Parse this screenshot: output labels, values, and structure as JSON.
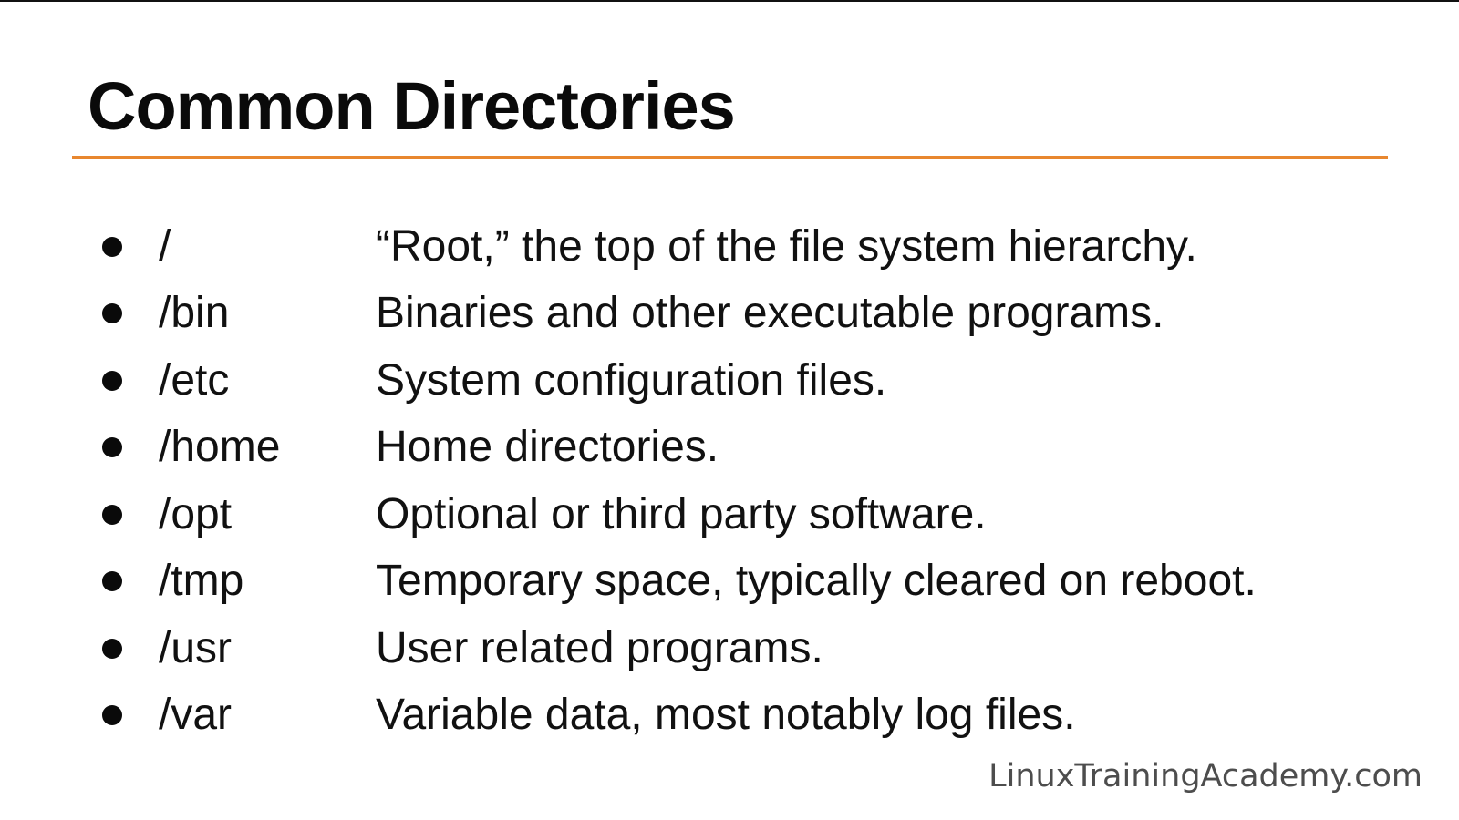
{
  "slide": {
    "title": "Common Directories",
    "accent_color": "#e8872f",
    "directories": [
      {
        "path": "/",
        "description": "“Root,” the top of the file system hierarchy."
      },
      {
        "path": "/bin",
        "description": "Binaries and other executable programs."
      },
      {
        "path": "/etc",
        "description": "System configuration files."
      },
      {
        "path": "/home",
        "description": "Home directories."
      },
      {
        "path": "/opt",
        "description": "Optional or third party software."
      },
      {
        "path": "/tmp",
        "description": "Temporary space, typically cleared on reboot."
      },
      {
        "path": "/usr",
        "description": "User related programs."
      },
      {
        "path": "/var",
        "description": "Variable data, most notably log files."
      }
    ],
    "watermark": "LinuxTrainingAcademy.com"
  }
}
